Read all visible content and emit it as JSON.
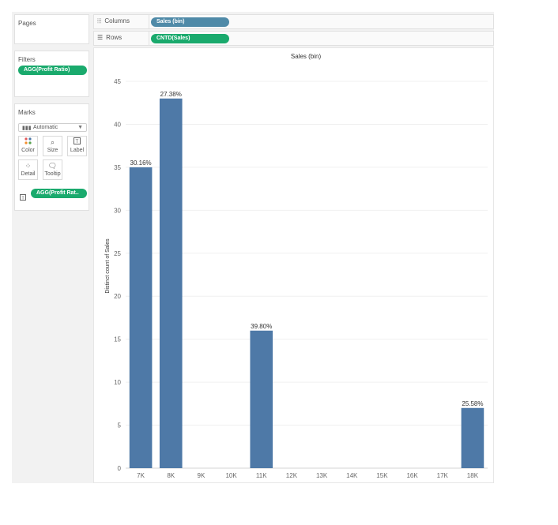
{
  "pages": {
    "title": "Pages"
  },
  "filters": {
    "title": "Filters",
    "pill": "AGG(Profit Ratio)"
  },
  "marks": {
    "title": "Marks",
    "type": "Automatic",
    "buttons": {
      "color": "Color",
      "size": "Size",
      "label": "Label",
      "detail": "Detail",
      "tooltip": "Tooltip"
    },
    "label_pill": "AGG(Profit Rat.."
  },
  "columns": {
    "label": "Columns",
    "pill": "Sales (bin)"
  },
  "rows": {
    "label": "Rows",
    "pill": "CNTD(Sales)"
  },
  "colors": {
    "bar": "#4e79a7",
    "green_pill": "#1aaa6d",
    "blue_pill": "#4f8aa8"
  },
  "chart_data": {
    "type": "bar",
    "title": "Sales (bin)",
    "xlabel": "",
    "ylabel": "Distinct count of Sales",
    "categories": [
      "7K",
      "8K",
      "9K",
      "10K",
      "11K",
      "12K",
      "13K",
      "14K",
      "15K",
      "16K",
      "17K",
      "18K"
    ],
    "values": [
      35,
      43,
      0,
      0,
      16,
      0,
      0,
      0,
      0,
      0,
      0,
      7
    ],
    "labels": [
      "30.16%",
      "27.38%",
      "",
      "",
      "39.80%",
      "",
      "",
      "",
      "",
      "",
      "",
      "25.58%"
    ],
    "ylim": [
      0,
      45
    ],
    "yticks": [
      0,
      5,
      10,
      15,
      20,
      25,
      30,
      35,
      40,
      45
    ],
    "grid": true
  }
}
